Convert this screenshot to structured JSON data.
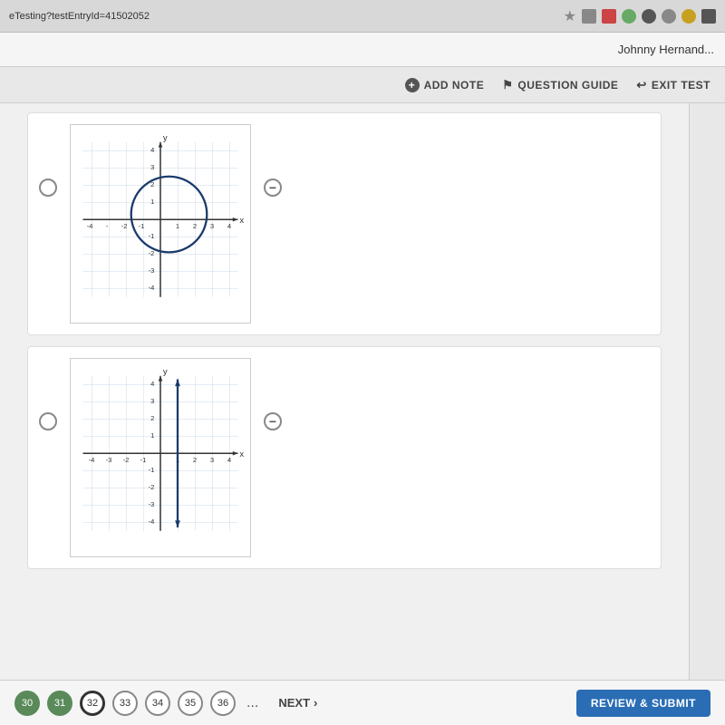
{
  "browser": {
    "url": "eTesting?testEntryId=41502052",
    "star_icon": "★",
    "browser_icons": [
      "■",
      "■",
      "■",
      "■",
      "■"
    ]
  },
  "topbar": {
    "user_name": "Johnny Hernand..."
  },
  "toolbar": {
    "add_note_label": "ADD NOTE",
    "question_guide_label": "QUESTION GUIDE",
    "exit_test_label": "EXIT TEST"
  },
  "graphs": [
    {
      "type": "circle",
      "description": "Circle centered at origin with radius ~2.5"
    },
    {
      "type": "vertical_line",
      "description": "Vertical line x=1 with arrows"
    }
  ],
  "bottom_nav": {
    "pages": [
      {
        "num": "30",
        "state": "checked"
      },
      {
        "num": "31",
        "state": "checked"
      },
      {
        "num": "32",
        "state": "active"
      },
      {
        "num": "33",
        "state": "normal"
      },
      {
        "num": "34",
        "state": "normal"
      },
      {
        "num": "35",
        "state": "normal"
      },
      {
        "num": "36",
        "state": "normal"
      }
    ],
    "dots": "...",
    "next_label": "NEXT",
    "review_label": "REVIEW & SUBMIT"
  }
}
